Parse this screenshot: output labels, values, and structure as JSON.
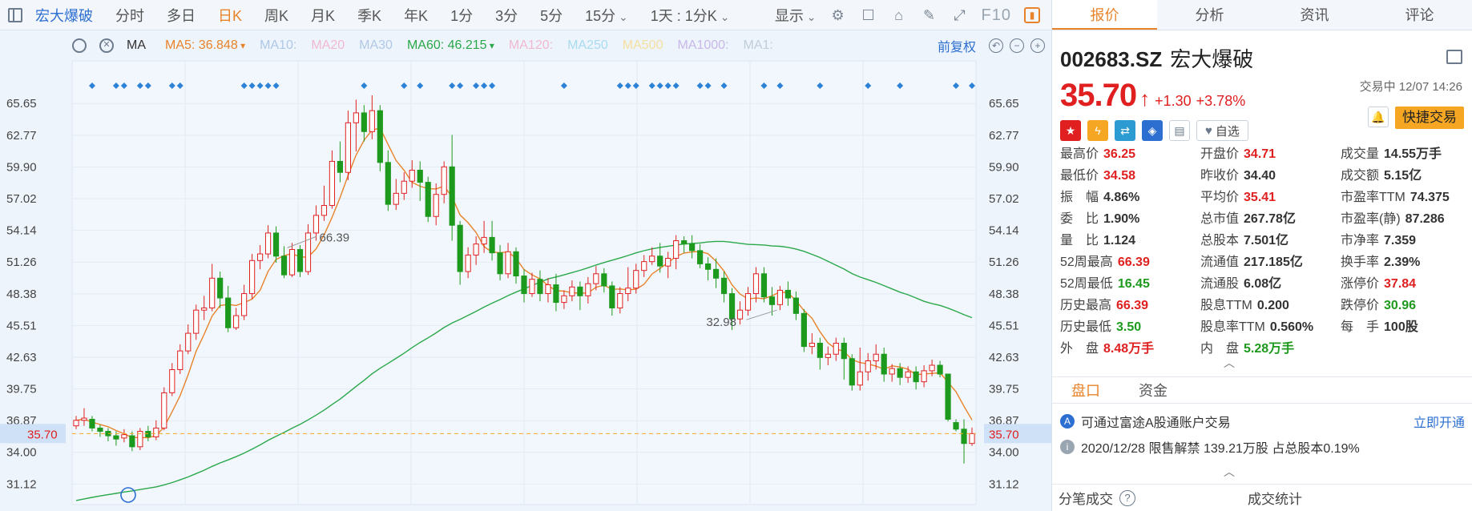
{
  "toolbar": {
    "stock_name": "宏大爆破",
    "periods": [
      "分时",
      "多日",
      "日K",
      "周K",
      "月K",
      "季K",
      "年K",
      "1分",
      "3分",
      "5分",
      "15分"
    ],
    "active_period": "日K",
    "range_label": "1天 : 1分K",
    "display_label": "显示",
    "f10_label": "F10"
  },
  "ma_bar": {
    "ma_label": "MA",
    "items": [
      {
        "text": "MA5: 36.848",
        "color": "#e8832a",
        "dropdown": true
      },
      {
        "text": "MA10:",
        "color": "#b0c8e6",
        "dropdown": false
      },
      {
        "text": "MA20",
        "color": "#f0b8d0",
        "dropdown": false
      },
      {
        "text": "MA30",
        "color": "#b0c8e6",
        "dropdown": false
      },
      {
        "text": "MA60: 46.215",
        "color": "#2aa84a",
        "dropdown": true
      },
      {
        "text": "MA120:",
        "color": "#f0b8d0",
        "dropdown": false
      },
      {
        "text": "MA250",
        "color": "#a8dcf0",
        "dropdown": false
      },
      {
        "text": "MA500",
        "color": "#f5e0a0",
        "dropdown": false
      },
      {
        "text": "MA1000:",
        "color": "#c8b8e8",
        "dropdown": false
      },
      {
        "text": "MA1:",
        "color": "#c0ccd8",
        "dropdown": false
      }
    ],
    "adjust_label": "前复权"
  },
  "chart_data": {
    "type": "candlestick",
    "y_ticks": [
      65.65,
      62.77,
      59.9,
      57.02,
      54.14,
      51.26,
      48.38,
      45.51,
      42.63,
      39.75,
      36.87,
      34.0,
      31.12
    ],
    "ylim": [
      29.4,
      68.5
    ],
    "current_price": 35.7,
    "high_annotation": {
      "value": "66.39",
      "index": 26
    },
    "low_annotation": {
      "value": "32.98",
      "index": 88
    },
    "up_color": "#e02020",
    "down_color": "#1d9a1d",
    "ma5_color": "#e8832a",
    "ma60_color": "#2aa84a",
    "ma60_end": 46.215,
    "candles": [
      [
        36.4,
        36.9,
        37.3,
        36.1
      ],
      [
        36.9,
        37.1,
        38.0,
        36.4
      ],
      [
        37.0,
        36.2,
        37.3,
        35.9
      ],
      [
        36.2,
        35.9,
        36.5,
        35.4
      ],
      [
        35.9,
        35.5,
        36.2,
        35.0
      ],
      [
        35.5,
        35.2,
        35.9,
        34.6
      ],
      [
        35.3,
        35.6,
        36.1,
        34.9
      ],
      [
        35.5,
        34.5,
        35.9,
        34.1
      ],
      [
        34.5,
        35.9,
        36.2,
        34.2
      ],
      [
        35.9,
        35.4,
        36.4,
        35.0
      ],
      [
        35.4,
        36.2,
        36.9,
        35.1
      ],
      [
        36.2,
        39.4,
        39.9,
        36.0
      ],
      [
        39.4,
        41.5,
        42.1,
        39.1
      ],
      [
        41.5,
        43.2,
        43.8,
        41.1
      ],
      [
        43.2,
        44.8,
        45.6,
        42.9
      ],
      [
        44.8,
        46.9,
        47.4,
        44.2
      ],
      [
        46.9,
        47.1,
        48.2,
        46.0
      ],
      [
        47.1,
        49.8,
        51.1,
        46.8
      ],
      [
        49.8,
        48.0,
        50.4,
        47.1
      ],
      [
        48.0,
        45.3,
        49.1,
        44.9
      ],
      [
        45.3,
        46.4,
        47.1,
        45.1
      ],
      [
        46.4,
        48.4,
        49.2,
        46.0
      ],
      [
        48.4,
        51.4,
        52.0,
        47.9
      ],
      [
        51.4,
        52.0,
        52.8,
        50.6
      ],
      [
        52.0,
        53.9,
        54.6,
        51.6
      ],
      [
        53.9,
        51.8,
        54.5,
        51.2
      ],
      [
        51.8,
        50.1,
        52.7,
        49.8
      ],
      [
        50.1,
        52.4,
        53.0,
        49.9
      ],
      [
        52.4,
        50.4,
        52.8,
        49.9
      ],
      [
        50.4,
        53.9,
        54.7,
        50.1
      ],
      [
        53.9,
        55.5,
        56.4,
        53.2
      ],
      [
        55.5,
        56.4,
        58.2,
        55.0
      ],
      [
        56.4,
        60.4,
        61.4,
        56.1
      ],
      [
        60.4,
        59.4,
        62.2,
        58.5
      ],
      [
        59.4,
        63.9,
        65.0,
        58.7
      ],
      [
        63.9,
        64.8,
        66.0,
        61.3
      ],
      [
        64.8,
        63.1,
        65.5,
        62.2
      ],
      [
        63.1,
        65.0,
        66.39,
        62.4
      ],
      [
        65.0,
        60.3,
        65.5,
        59.5
      ],
      [
        60.3,
        56.5,
        61.4,
        55.9
      ],
      [
        56.5,
        57.5,
        58.8,
        56.0
      ],
      [
        57.5,
        58.6,
        59.4,
        56.9
      ],
      [
        58.6,
        59.6,
        60.5,
        58.0
      ],
      [
        59.6,
        58.5,
        60.4,
        56.8
      ],
      [
        58.5,
        55.4,
        59.0,
        54.9
      ],
      [
        55.4,
        57.4,
        58.4,
        54.6
      ],
      [
        57.4,
        59.9,
        60.4,
        56.6
      ],
      [
        59.9,
        54.6,
        62.8,
        53.2
      ],
      [
        54.6,
        50.4,
        55.0,
        49.2
      ],
      [
        50.4,
        51.9,
        52.6,
        49.8
      ],
      [
        51.9,
        52.9,
        53.6,
        51.0
      ],
      [
        52.9,
        53.5,
        55.0,
        52.1
      ],
      [
        53.5,
        52.1,
        55.0,
        51.4
      ],
      [
        52.1,
        50.2,
        52.8,
        49.6
      ],
      [
        50.2,
        52.2,
        53.0,
        49.8
      ],
      [
        52.2,
        50.0,
        52.6,
        49.3
      ],
      [
        50.0,
        48.4,
        50.6,
        47.6
      ],
      [
        48.4,
        49.7,
        50.3,
        48.1
      ],
      [
        49.7,
        48.4,
        50.5,
        47.7
      ],
      [
        48.4,
        49.2,
        49.8,
        47.6
      ],
      [
        49.2,
        47.6,
        50.2,
        46.8
      ],
      [
        47.6,
        48.2,
        48.7,
        47.0
      ],
      [
        48.2,
        49.0,
        49.6,
        47.7
      ],
      [
        49.0,
        48.2,
        49.5,
        46.9
      ],
      [
        48.2,
        49.3,
        49.9,
        47.5
      ],
      [
        49.3,
        50.2,
        50.9,
        48.7
      ],
      [
        50.2,
        49.1,
        50.7,
        48.5
      ],
      [
        49.1,
        47.1,
        49.5,
        46.4
      ],
      [
        47.1,
        48.4,
        49.0,
        46.6
      ],
      [
        48.4,
        48.9,
        50.8,
        47.7
      ],
      [
        48.9,
        50.5,
        51.1,
        48.4
      ],
      [
        50.5,
        51.3,
        51.9,
        49.9
      ],
      [
        51.3,
        51.8,
        52.6,
        51.0
      ],
      [
        51.8,
        50.9,
        53.0,
        50.3
      ],
      [
        50.9,
        51.6,
        52.2,
        49.8
      ],
      [
        51.6,
        53.2,
        53.7,
        50.6
      ],
      [
        53.2,
        52.9,
        53.6,
        52.1
      ],
      [
        52.9,
        52.3,
        53.7,
        51.6
      ],
      [
        52.3,
        51.1,
        52.9,
        50.7
      ],
      [
        51.1,
        50.6,
        51.7,
        49.6
      ],
      [
        50.6,
        49.8,
        51.6,
        48.9
      ],
      [
        49.8,
        48.4,
        50.4,
        47.6
      ],
      [
        48.4,
        46.1,
        48.9,
        45.1
      ],
      [
        46.1,
        46.9,
        47.7,
        45.6
      ],
      [
        46.9,
        48.4,
        49.0,
        46.4
      ],
      [
        48.4,
        50.2,
        50.8,
        47.6
      ],
      [
        50.2,
        48.1,
        50.8,
        47.6
      ],
      [
        48.1,
        47.4,
        49.0,
        46.4
      ],
      [
        47.4,
        48.7,
        49.1,
        46.9
      ],
      [
        48.7,
        48.0,
        49.5,
        47.3
      ],
      [
        48.0,
        46.6,
        48.6,
        46.0
      ],
      [
        46.6,
        43.6,
        47.0,
        43.1
      ],
      [
        43.6,
        43.9,
        44.8,
        42.9
      ],
      [
        43.9,
        42.6,
        44.4,
        41.5
      ],
      [
        42.6,
        42.9,
        43.6,
        41.9
      ],
      [
        42.9,
        43.9,
        44.4,
        42.3
      ],
      [
        43.9,
        42.5,
        44.4,
        40.6
      ],
      [
        42.5,
        40.1,
        42.9,
        39.6
      ],
      [
        40.1,
        41.3,
        43.5,
        39.6
      ],
      [
        41.3,
        42.3,
        43.0,
        40.5
      ],
      [
        42.3,
        42.9,
        43.8,
        41.5
      ],
      [
        42.9,
        41.1,
        43.5,
        40.4
      ],
      [
        41.1,
        41.6,
        42.0,
        40.4
      ],
      [
        41.6,
        40.8,
        42.1,
        40.1
      ],
      [
        40.8,
        41.3,
        41.8,
        40.3
      ],
      [
        41.3,
        40.4,
        41.8,
        39.7
      ],
      [
        40.4,
        41.4,
        41.9,
        39.9
      ],
      [
        41.4,
        41.9,
        42.4,
        40.9
      ],
      [
        41.9,
        41.1,
        42.3,
        40.8
      ],
      [
        41.1,
        37.0,
        37.2,
        36.8
      ],
      [
        36.7,
        36.1,
        37.0,
        35.9
      ],
      [
        36.1,
        34.8,
        37.0,
        32.98
      ],
      [
        34.8,
        35.7,
        36.25,
        34.58
      ]
    ],
    "marks": [
      2,
      5,
      6,
      8,
      9,
      12,
      13,
      21,
      22,
      23,
      24,
      25,
      36,
      41,
      43,
      47,
      48,
      50,
      51,
      52,
      61,
      68,
      69,
      70,
      72,
      73,
      74,
      75,
      78,
      79,
      81,
      86,
      88,
      93,
      99,
      103,
      110,
      112
    ]
  },
  "panel": {
    "tabs": [
      "报价",
      "分析",
      "资讯",
      "评论"
    ],
    "active_tab": "报价",
    "code": "002683.SZ",
    "name": "宏大爆破",
    "price": "35.70",
    "change": "+1.30",
    "change_pct": "+3.78%",
    "status": "交易中 12/07 14:26",
    "watch_label": "自选",
    "quick_trade": "快捷交易",
    "stats": [
      [
        {
          "l": "最高价",
          "v": "36.25",
          "c": "up"
        },
        {
          "l": "开盘价",
          "v": "34.71",
          "c": "up"
        },
        {
          "l": "成交量",
          "v": "14.55万手",
          "c": ""
        }
      ],
      [
        {
          "l": "最低价",
          "v": "34.58",
          "c": "up"
        },
        {
          "l": "昨收价",
          "v": "34.40",
          "c": ""
        },
        {
          "l": "成交额",
          "v": "5.15亿",
          "c": ""
        }
      ],
      [
        {
          "l": "振　幅",
          "v": "4.86%",
          "c": ""
        },
        {
          "l": "平均价",
          "v": "35.41",
          "c": "up"
        },
        {
          "l": "市盈率TTM",
          "v": "74.375",
          "c": ""
        }
      ],
      [
        {
          "l": "委　比",
          "v": "1.90%",
          "c": ""
        },
        {
          "l": "总市值",
          "v": "267.78亿",
          "c": ""
        },
        {
          "l": "市盈率(静)",
          "v": "87.286",
          "c": ""
        }
      ],
      [
        {
          "l": "量　比",
          "v": "1.124",
          "c": ""
        },
        {
          "l": "总股本",
          "v": "7.501亿",
          "c": ""
        },
        {
          "l": "市净率",
          "v": "7.359",
          "c": ""
        }
      ],
      [
        {
          "l": "52周最高",
          "v": "66.39",
          "c": "up"
        },
        {
          "l": "流通值",
          "v": "217.185亿",
          "c": ""
        },
        {
          "l": "换手率",
          "v": "2.39%",
          "c": ""
        }
      ],
      [
        {
          "l": "52周最低",
          "v": "16.45",
          "c": "down"
        },
        {
          "l": "流通股",
          "v": "6.08亿",
          "c": ""
        },
        {
          "l": "涨停价",
          "v": "37.84",
          "c": "up"
        }
      ],
      [
        {
          "l": "历史最高",
          "v": "66.39",
          "c": "up"
        },
        {
          "l": "股息TTM",
          "v": "0.200",
          "c": ""
        },
        {
          "l": "跌停价",
          "v": "30.96",
          "c": "down"
        }
      ],
      [
        {
          "l": "历史最低",
          "v": "3.50",
          "c": "down"
        },
        {
          "l": "股息率TTM",
          "v": "0.560%",
          "c": ""
        },
        {
          "l": "每　手",
          "v": "100股",
          "c": ""
        }
      ],
      [
        {
          "l": "外　盘",
          "v": "8.48万手",
          "c": "up"
        },
        {
          "l": "内　盘",
          "v": "5.28万手",
          "c": "down"
        },
        {
          "l": "",
          "v": "",
          "c": ""
        }
      ]
    ],
    "section_tabs": [
      "盘口",
      "资金"
    ],
    "active_section": "盘口",
    "notice1": "可通过富途A股通账户交易",
    "notice1_link": "立即开通",
    "notice2": "2020/12/28  限售解禁 139.21万股 占总股本0.19%",
    "bottom_left": "分笔成交",
    "bottom_right": "成交统计"
  }
}
